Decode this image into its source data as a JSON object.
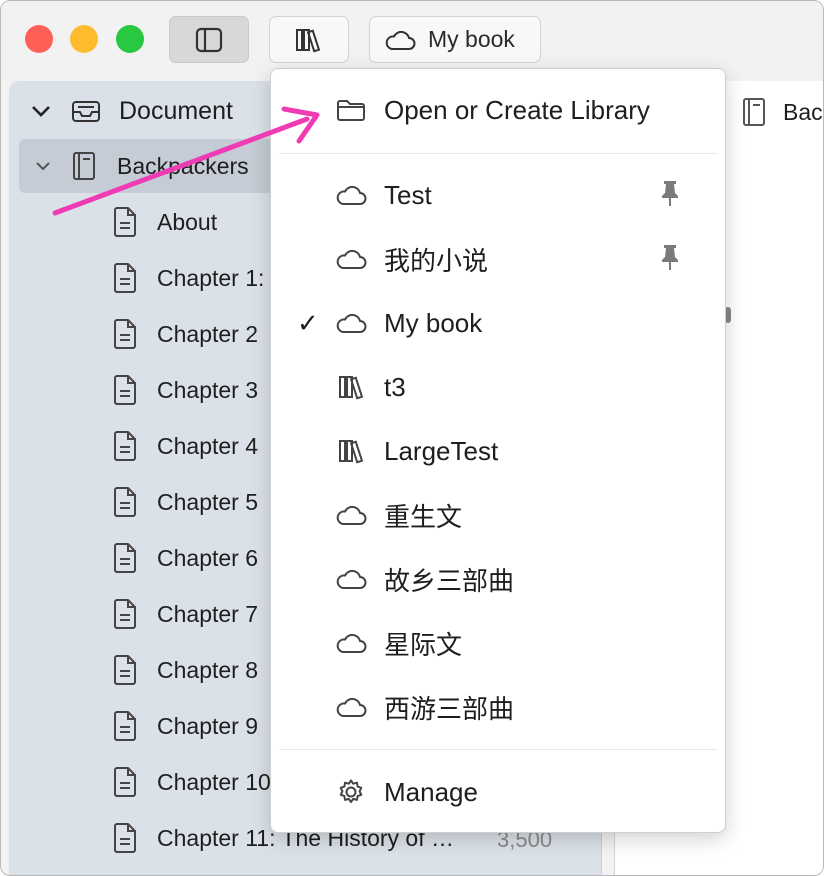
{
  "toolbar": {
    "library_label": "My book"
  },
  "sidebar": {
    "root": "Document",
    "book": "Backpackers",
    "items": [
      {
        "label": "About"
      },
      {
        "label": "Chapter 1:"
      },
      {
        "label": "Chapter 2"
      },
      {
        "label": "Chapter 3"
      },
      {
        "label": "Chapter 4"
      },
      {
        "label": "Chapter 5"
      },
      {
        "label": "Chapter 6"
      },
      {
        "label": "Chapter 7"
      },
      {
        "label": "Chapter 8"
      },
      {
        "label": "Chapter 9"
      },
      {
        "label": "Chapter 10"
      },
      {
        "label": "Chapter 11: The History of …",
        "count": "3,500"
      }
    ]
  },
  "main": {
    "title": "Bac"
  },
  "menu": {
    "open_label": "Open or Create Library",
    "libraries": [
      {
        "label": "Test",
        "icon": "cloud-icon",
        "pinned": true,
        "checked": false
      },
      {
        "label": "我的小说",
        "icon": "cloud-icon",
        "pinned": true,
        "checked": false
      },
      {
        "label": "My book",
        "icon": "cloud-icon",
        "pinned": false,
        "checked": true
      },
      {
        "label": "t3",
        "icon": "library-icon",
        "pinned": false,
        "checked": false
      },
      {
        "label": "LargeTest",
        "icon": "library-icon",
        "pinned": false,
        "checked": false
      },
      {
        "label": "重生文",
        "icon": "cloud-icon",
        "pinned": false,
        "checked": false
      },
      {
        "label": "故乡三部曲",
        "icon": "cloud-icon",
        "pinned": false,
        "checked": false
      },
      {
        "label": "星际文",
        "icon": "cloud-icon",
        "pinned": false,
        "checked": false
      },
      {
        "label": "西游三部曲",
        "icon": "cloud-icon",
        "pinned": false,
        "checked": false
      }
    ],
    "check_glyph": "✓",
    "manage_label": "Manage"
  },
  "colors": {
    "sidebar_bg": "#dbe1e9",
    "selected_row": "#c5ccd6",
    "annotation_arrow": "#f03cb4"
  }
}
